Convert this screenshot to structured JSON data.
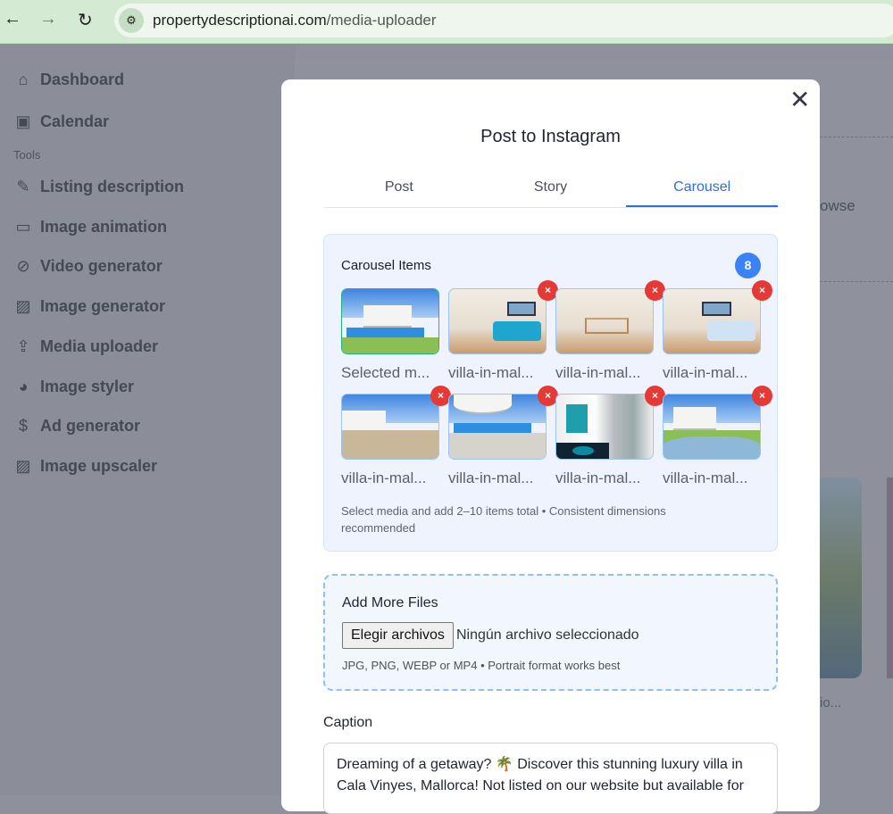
{
  "browser": {
    "url_domain": "propertydescriptionai.com",
    "url_path": "/media-uploader"
  },
  "sidebar": {
    "top": [
      {
        "label": "Dashboard",
        "icon": "home-icon"
      },
      {
        "label": "Calendar",
        "icon": "calendar-icon"
      }
    ],
    "section": "Tools",
    "items": [
      {
        "label": "Listing description",
        "icon": "pencil-icon"
      },
      {
        "label": "Image animation",
        "icon": "video-camera-icon"
      },
      {
        "label": "Video generator",
        "icon": "video-off-icon"
      },
      {
        "label": "Image generator",
        "icon": "image-icon"
      },
      {
        "label": "Media uploader",
        "icon": "upload-icon"
      },
      {
        "label": "Image styler",
        "icon": "palette-icon"
      },
      {
        "label": "Ad generator",
        "icon": "dollar-icon"
      },
      {
        "label": "Image upscaler",
        "icon": "image-icon"
      }
    ]
  },
  "background": {
    "browse_fragment": "owse",
    "card_fragment": "io..."
  },
  "modal": {
    "title": "Post to Instagram",
    "tabs": [
      {
        "label": "Post"
      },
      {
        "label": "Story"
      },
      {
        "label": "Carousel",
        "active": true
      }
    ],
    "carousel": {
      "title": "Carousel Items",
      "count": "8",
      "items": [
        {
          "label": "Selected m...",
          "type": "exterior",
          "removable": false
        },
        {
          "label": "villa-in-mal...",
          "type": "living"
        },
        {
          "label": "villa-in-mal...",
          "type": "stairs"
        },
        {
          "label": "villa-in-mal...",
          "type": "bedroom"
        },
        {
          "label": "villa-in-mal...",
          "type": "terrace"
        },
        {
          "label": "villa-in-mal...",
          "type": "umbrella"
        },
        {
          "label": "villa-in-mal...",
          "type": "kitchen"
        },
        {
          "label": "villa-in-mal...",
          "type": "jacuzzi"
        }
      ],
      "remove_label": "×",
      "note": "Select media and add 2–10 items total • Consistent dimensions recommended"
    },
    "add_files": {
      "title": "Add More Files",
      "button": "Elegir archivos",
      "status": "Ningún archivo seleccionado",
      "hint": "JPG, PNG, WEBP or MP4 • Portrait format works best"
    },
    "caption": {
      "label": "Caption",
      "value": "Dreaming of a getaway? 🌴 Discover this stunning luxury villa in Cala Vinyes, Mallorca! Not listed on our website but available for"
    }
  },
  "colors": {
    "accent": "#2b6fe0",
    "badge": "#3b82f6",
    "remove": "#e53935"
  }
}
